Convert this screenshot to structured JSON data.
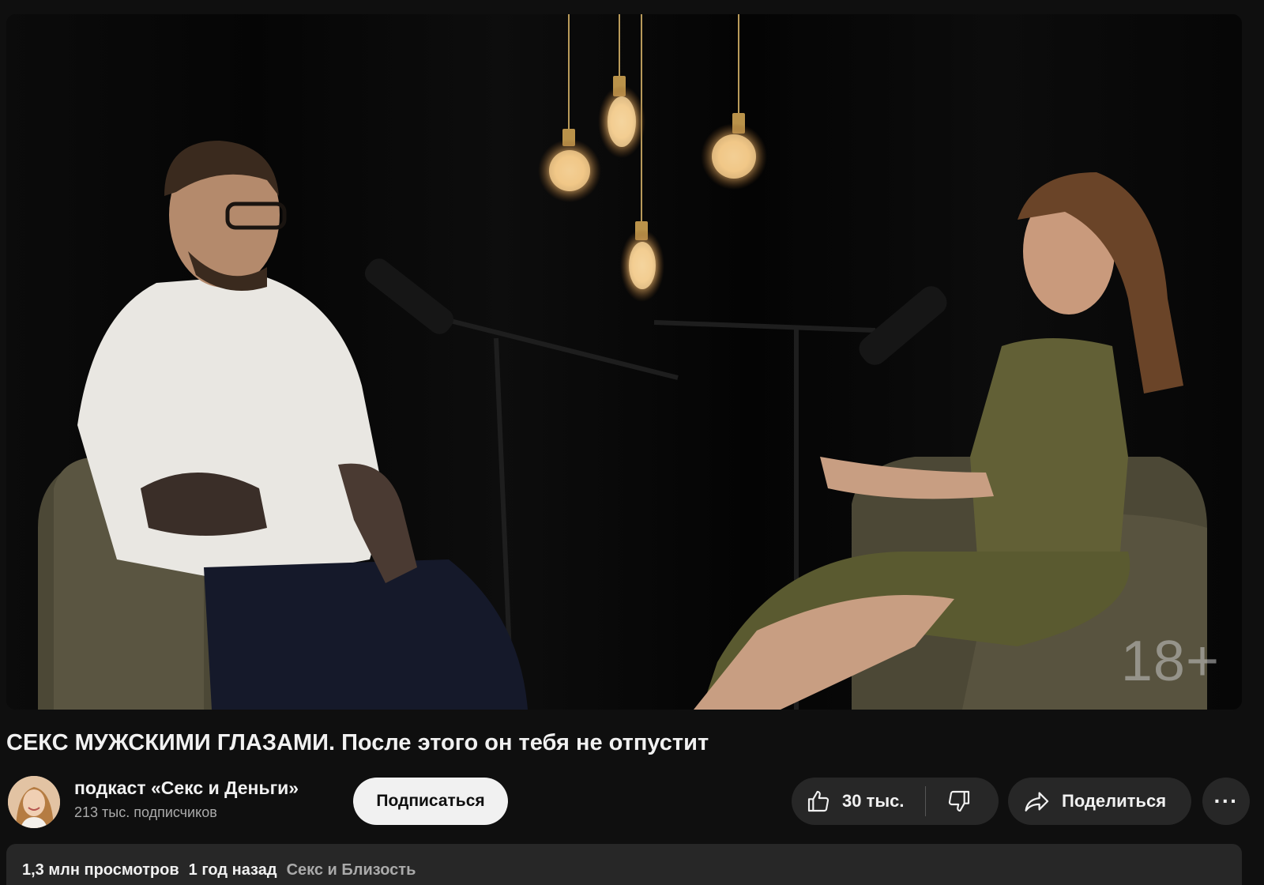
{
  "player": {
    "overlay_badge": "18+"
  },
  "video": {
    "title": "СЕКС МУЖСКИМИ ГЛАЗАМИ. После этого он тебя не отпустит"
  },
  "channel": {
    "name": "подкаст «Секс и Деньги»",
    "subscribers": "213 тыс. подписчиков",
    "avatar_icon": "channel-avatar"
  },
  "actions": {
    "subscribe_label": "Подписаться",
    "like_count": "30 тыс.",
    "like_icon": "thumbs-up-icon",
    "dislike_icon": "thumbs-down-icon",
    "share_label": "Поделиться",
    "share_icon": "share-arrow-icon",
    "more_label": "···"
  },
  "description": {
    "views": "1,3 млн просмотров",
    "published": "1 год назад",
    "category": "Секс и Близость"
  },
  "colors": {
    "background": "#0f0f0f",
    "button_bg": "#272727",
    "subscribe_bg": "#f1f1f1",
    "secondary_text": "#aaaaaa"
  }
}
